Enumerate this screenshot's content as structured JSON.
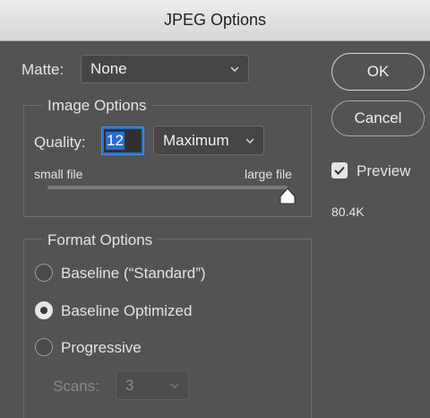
{
  "window": {
    "title": "JPEG Options"
  },
  "matte": {
    "label": "Matte:",
    "value": "None"
  },
  "image_options": {
    "title": "Image Options",
    "quality_label": "Quality:",
    "quality_value": "12",
    "quality_preset": "Maximum",
    "slider_left_label": "small file",
    "slider_right_label": "large file",
    "slider_value": 12,
    "slider_max": 12
  },
  "format_options": {
    "title": "Format Options",
    "options": [
      {
        "label": "Baseline (“Standard”)",
        "selected": false
      },
      {
        "label": "Baseline Optimized",
        "selected": true
      },
      {
        "label": "Progressive",
        "selected": false
      }
    ],
    "scans_label": "Scans:",
    "scans_value": "3"
  },
  "buttons": {
    "ok": "OK",
    "cancel": "Cancel"
  },
  "preview": {
    "label": "Preview",
    "checked": true,
    "file_size": "80.4K"
  }
}
